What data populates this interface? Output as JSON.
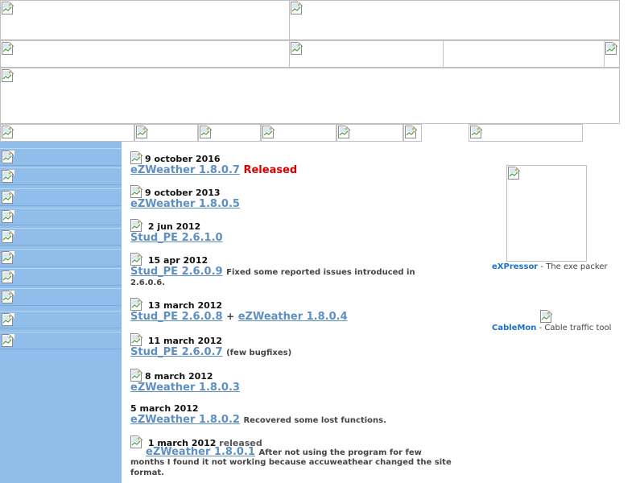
{
  "colors": {
    "sidebar": "#90bde9",
    "link": "#5d8fc4",
    "released": "#d60000",
    "side_link": "#1a73c8"
  },
  "icons": {
    "broken_image": "broken-image-icon"
  },
  "news": [
    {
      "date": "9 october 2016",
      "link": "eZWeather 1.8.0.7",
      "extra": "Released"
    },
    {
      "date": "9 october 2013",
      "link": "eZWeather 1.8.0.5"
    },
    {
      "date": "2 jun 2012",
      "link": "Stud_PE 2.6.1.0"
    },
    {
      "date": "15 apr 2012",
      "link": "Stud_PE 2.6.0.9",
      "desc1": "Fixed some reported issues introduced in",
      "desc2": "2.6.0.6."
    },
    {
      "date": "13 march 2012",
      "link": "Stud_PE 2.6.0.8",
      "plus": "+",
      "link2": "eZWeather 1.8.0.4"
    },
    {
      "date": "11 march 2012",
      "link": "Stud_PE 2.6.0.7",
      "desc": "(few bugfixes)"
    },
    {
      "date": "8 march 2012",
      "link": "eZWeather 1.8.0.3"
    },
    {
      "date": "5 march 2012",
      "link": "eZWeather 1.8.0.2",
      "desc": "Recovered some lost functions."
    },
    {
      "date": "1 march 2012",
      "suffix": "released",
      "link": "eZWeather 1.8.0.1",
      "desc1": "After not using the program for few",
      "desc2": "months I found it not working because accuweathear changed the site",
      "desc3": "format."
    }
  ],
  "side_products": [
    {
      "name": "eXPressor",
      "sep": " - ",
      "text": "The exe packer"
    },
    {
      "name": "CableMon",
      "sep": " - ",
      "text": "Cable traffic tool"
    }
  ]
}
